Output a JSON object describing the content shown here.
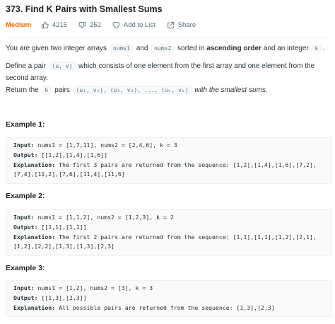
{
  "problem": {
    "title": "373. Find K Pairs with Smallest Sums",
    "difficulty": "Medium",
    "likes": "4215",
    "dislikes": "252",
    "add_to_list": "Add to List",
    "share": "Share"
  },
  "description": {
    "p1_a": "You are given two integer arrays",
    "p1_code1": "nums1",
    "p1_b": "and",
    "p1_code2": "nums2",
    "p1_c": "sorted in",
    "p1_bold": "ascending order",
    "p1_d": "and an integer",
    "p1_code3": "k",
    "p1_e": ".",
    "p2_a": "Define a pair",
    "p2_code": "(u, v)",
    "p2_b": "which consists of one element from the first array and one element from the second array.",
    "p3_a": "Return the",
    "p3_code1": "k",
    "p3_b": "pairs",
    "p3_code2": "(u₁, v₁), (u₂, v₂), ..., (uₖ, vₖ)",
    "p3_c": "with the smallest sums."
  },
  "examples": [
    {
      "heading": "Example 1:",
      "input_label": "Input:",
      "input": "nums1 = [1,7,11], nums2 = [2,4,6], k = 3",
      "output_label": "Output:",
      "output": "[[1,2],[1,4],[1,6]]",
      "explanation_label": "Explanation:",
      "explanation": "The first 3 pairs are returned from the sequence: [1,2],[1,4],[1,6],[7,2],[7,4],[11,2],[7,6],[11,4],[11,6]"
    },
    {
      "heading": "Example 2:",
      "input_label": "Input:",
      "input": "nums1 = [1,1,2], nums2 = [1,2,3], k = 2",
      "output_label": "Output:",
      "output": "[[1,1],[1,1]]",
      "explanation_label": "Explanation:",
      "explanation": "The first 2 pairs are returned from the sequence: [1,1],[1,1],[1,2],[2,1],[1,2],[2,2],[1,3],[1,3],[2,3]"
    },
    {
      "heading": "Example 3:",
      "input_label": "Input:",
      "input": "nums1 = [1,2], nums2 = [3], k = 3",
      "output_label": "Output:",
      "output": "[[1,3],[2,3]]",
      "explanation_label": "Explanation:",
      "explanation": "All possible pairs are returned from the sequence: [1,3],[2,3]"
    }
  ],
  "icons": {
    "likes": "thumbs-up-icon",
    "dislikes": "thumbs-down-icon",
    "add_to_list": "heart-icon",
    "share": "share-icon"
  },
  "colors": {
    "difficulty": "#ef6c00",
    "meta_text": "#546e7a",
    "code_bg": "#fafafa"
  }
}
